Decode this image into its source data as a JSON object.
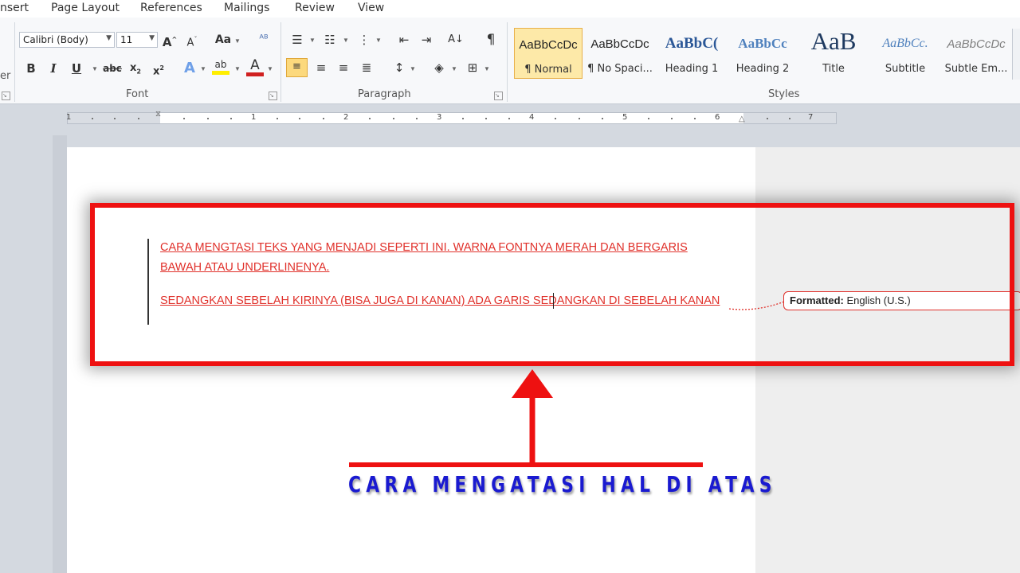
{
  "tabs": [
    "nsert",
    "Page Layout",
    "References",
    "Mailings",
    "Review",
    "View"
  ],
  "clipboard_partial_label": "er",
  "font": {
    "name": "Calibri (Body)",
    "size": "11",
    "group_label": "Font"
  },
  "paragraph": {
    "group_label": "Paragraph"
  },
  "styles": {
    "group_label": "Styles",
    "items": [
      {
        "sample": "AaBbCcDc",
        "name": "¶ Normal"
      },
      {
        "sample": "AaBbCcDc",
        "name": "¶ No Spaci..."
      },
      {
        "sample": "AaBbC(",
        "name": "Heading 1"
      },
      {
        "sample": "AaBbCc",
        "name": "Heading 2"
      },
      {
        "sample": "AaB",
        "name": "Title"
      },
      {
        "sample": "AaBbCc.",
        "name": "Subtitle"
      },
      {
        "sample": "AaBbCcDc",
        "name": "Subtle Em..."
      }
    ]
  },
  "ruler": {
    "numbers": [
      "1",
      "1",
      "2",
      "3",
      "4",
      "5",
      "6",
      "7"
    ]
  },
  "document": {
    "line1": "CARA MENGTASI TEKS YANG MENJADI SEPERTI INI. WARNA FONTNYA MERAH DAN BERGARIS",
    "line2": "BAWAH ATAU UNDERLINENYA.",
    "line3": "SEDANGKAN SEBELAH KIRINYA (BISA JUGA DI KANAN) ADA GARIS SEDANGKAN DI SEBELAH KANAN"
  },
  "balloon": {
    "label": "Formatted:",
    "value": " English (U.S.)"
  },
  "caption": "CARA MENGATASI HAL DI ATAS",
  "colors": {
    "revision_text": "#e0302a",
    "annotation_red": "#ee1111",
    "caption_blue": "#1a1ad0"
  },
  "icons": [
    "grow-font-icon",
    "shrink-font-icon",
    "change-case-icon",
    "clear-format-icon",
    "bullets-icon",
    "numbering-icon",
    "multilevel-list-icon",
    "decrease-indent-icon",
    "increase-indent-icon",
    "sort-icon",
    "show-marks-icon",
    "bold-icon",
    "italic-icon",
    "underline-icon",
    "strikethrough-icon",
    "subscript-icon",
    "superscript-icon",
    "text-effects-icon",
    "highlight-icon",
    "font-color-icon",
    "align-left-icon",
    "center-icon",
    "align-right-icon",
    "justify-icon",
    "line-spacing-icon",
    "shading-icon",
    "borders-icon"
  ]
}
